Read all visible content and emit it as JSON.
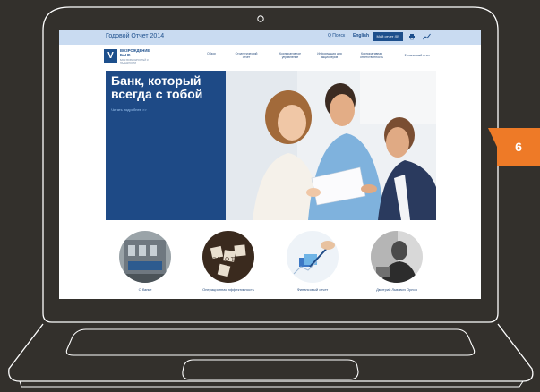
{
  "colors": {
    "background": "#33302c",
    "brand": "#1d4f8c",
    "topbar": "#c9dbf1",
    "badge": "#ee7a27"
  },
  "topbar": {
    "title": "Годовой Отчет 2014",
    "search_label": "Q Поиск",
    "lang_label": "English",
    "my_report_label": "Мой отчет (0)",
    "icons": [
      "print-icon",
      "chart-icon"
    ]
  },
  "logo": {
    "name": "ВОЗРОЖДЕНИЕ БАНК",
    "tagline": "БАНК ВОЗМОЖНОСТЕЙ И НАДЕЖНОСТИ"
  },
  "nav": {
    "items": [
      "Обзор",
      "Стратегический отчет",
      "Корпоративное управление",
      "Информация для акционеров",
      "Корпоративная ответственность",
      "Финансовый отчет"
    ]
  },
  "hero": {
    "headline": "Банк, который всегда с тобой",
    "more_link": "Читать подробнее >>"
  },
  "circles": [
    {
      "label": "О банке"
    },
    {
      "label": "Операционная эффективность"
    },
    {
      "label": "Финансовый отчет"
    },
    {
      "label": "Дмитрий Львович Орлов"
    }
  ],
  "page_badge": "6"
}
